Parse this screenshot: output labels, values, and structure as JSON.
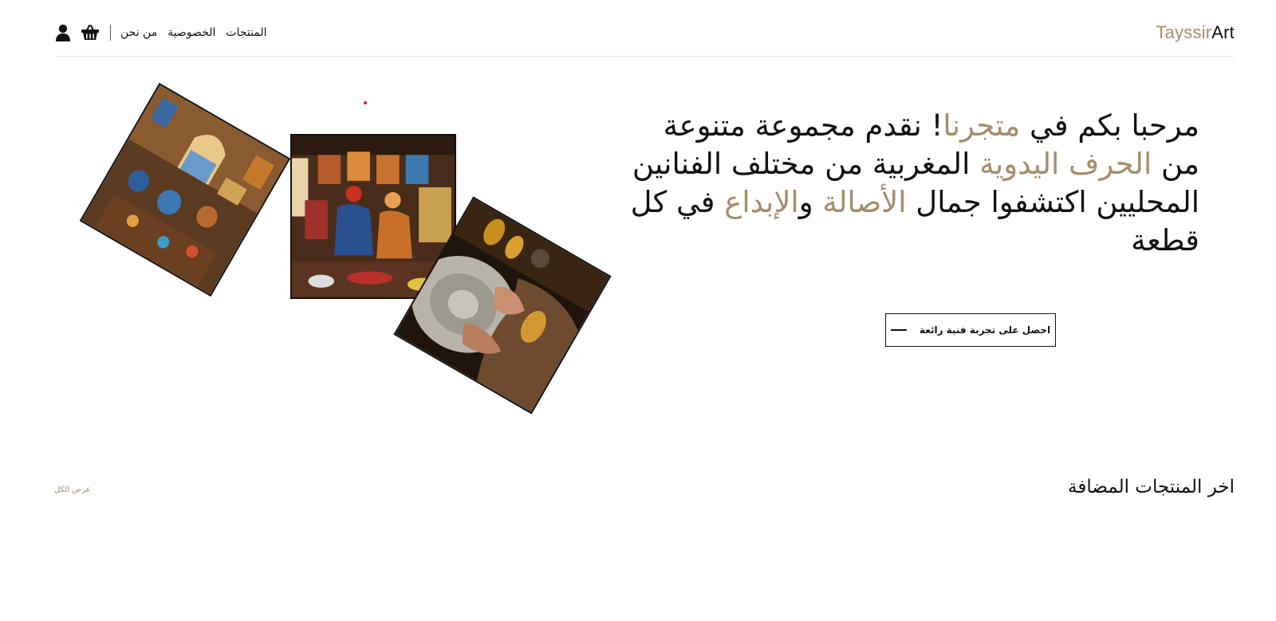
{
  "brand": {
    "part1": "Tayssir",
    "part2": "Art",
    "accent_color": "#a48d6b",
    "text_color": "#111111"
  },
  "nav": {
    "items": [
      {
        "label": "المنتجات"
      },
      {
        "label": "الخصوصية"
      },
      {
        "label": "من نحن"
      }
    ],
    "icons": [
      "cart-icon",
      "user-icon"
    ]
  },
  "hero": {
    "segments": [
      {
        "text": "مرحبا بكم في ",
        "highlight": false
      },
      {
        "text": "متجرنا",
        "highlight": true
      },
      {
        "text": "! نقدم مجموعة متنوعة من ",
        "highlight": false
      },
      {
        "text": "الحرف اليدوية",
        "highlight": true
      },
      {
        "text": " المغربية من مختلف الفنانين المحليين اكتشفوا جمال ",
        "highlight": false
      },
      {
        "text": "الأصالة",
        "highlight": true
      },
      {
        "text": " و",
        "highlight": false
      },
      {
        "text": "الإبداع",
        "highlight": true
      },
      {
        "text": " في كل قطعة",
        "highlight": false
      }
    ],
    "cta_label": "احصل على تجربة فنية رائعة"
  },
  "latest": {
    "title": "اخر المنتجات المضافة",
    "view_all": "عرض الكل"
  }
}
